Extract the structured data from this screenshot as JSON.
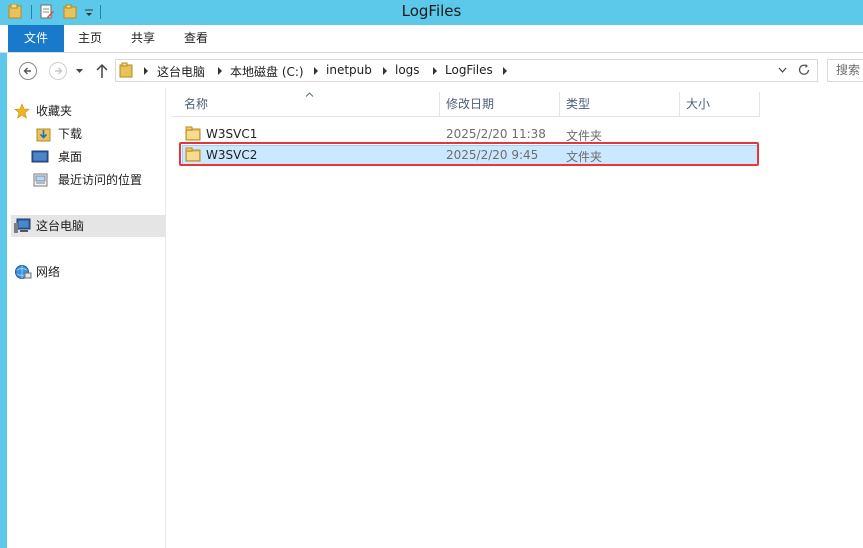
{
  "window": {
    "title": "LogFiles"
  },
  "ribbon": {
    "tabs": [
      "文件",
      "主页",
      "共享",
      "查看"
    ]
  },
  "address": {
    "crumbs": [
      "这台电脑",
      "本地磁盘 (C:)",
      "inetpub",
      "logs",
      "LogFiles"
    ],
    "search_placeholder": "搜索"
  },
  "nav": {
    "favorites": "收藏夹",
    "downloads": "下载",
    "desktop": "桌面",
    "recent": "最近访问的位置",
    "thispc": "这台电脑",
    "network": "网络"
  },
  "columns": [
    "名称",
    "修改日期",
    "类型",
    "大小"
  ],
  "files": [
    {
      "name": "W3SVC1",
      "modified": "2025/2/20 11:38",
      "type": "文件夹",
      "size": ""
    },
    {
      "name": "W3SVC2",
      "modified": "2025/2/20 9:45",
      "type": "文件夹",
      "size": ""
    }
  ],
  "colors": {
    "title_bar": "#5cc8ea",
    "file_tab": "#1979ca",
    "selection": "#cce8ff",
    "highlight_border": "#e8353b",
    "folder": "#e8c25a"
  }
}
